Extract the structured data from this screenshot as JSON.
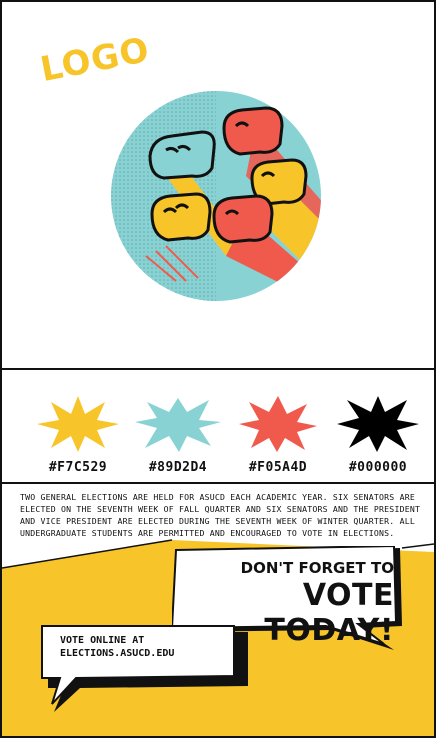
{
  "logo": {
    "text": "LOGO"
  },
  "illustration": {
    "name": "raised-fists-illustration",
    "colors": {
      "background": "#89D2D4",
      "fist_red": "#F05A4D",
      "fist_yellow": "#F7C529"
    }
  },
  "palette": [
    {
      "hex": "#F7C529",
      "label": "#F7C529"
    },
    {
      "hex": "#89D2D4",
      "label": "#89D2D4"
    },
    {
      "hex": "#F05A4D",
      "label": "#F05A4D"
    },
    {
      "hex": "#000000",
      "label": "#000000"
    }
  ],
  "description": "Two general elections are held for ASUCD each academic year. Six senators are elected on the seventh week of fall quarter and six senators and the president and vice president are elected during the seventh week of winter quarter. All undergraduate students are permitted and encouraged to vote in elections.",
  "poster": {
    "headline_small": "DON'T FORGET TO",
    "headline_big": "VOTE TODAY!",
    "online_line1": "VOTE ONLINE AT",
    "online_line2": "ELECTIONS.ASUCD.EDU",
    "bg_color": "#F7C529"
  }
}
